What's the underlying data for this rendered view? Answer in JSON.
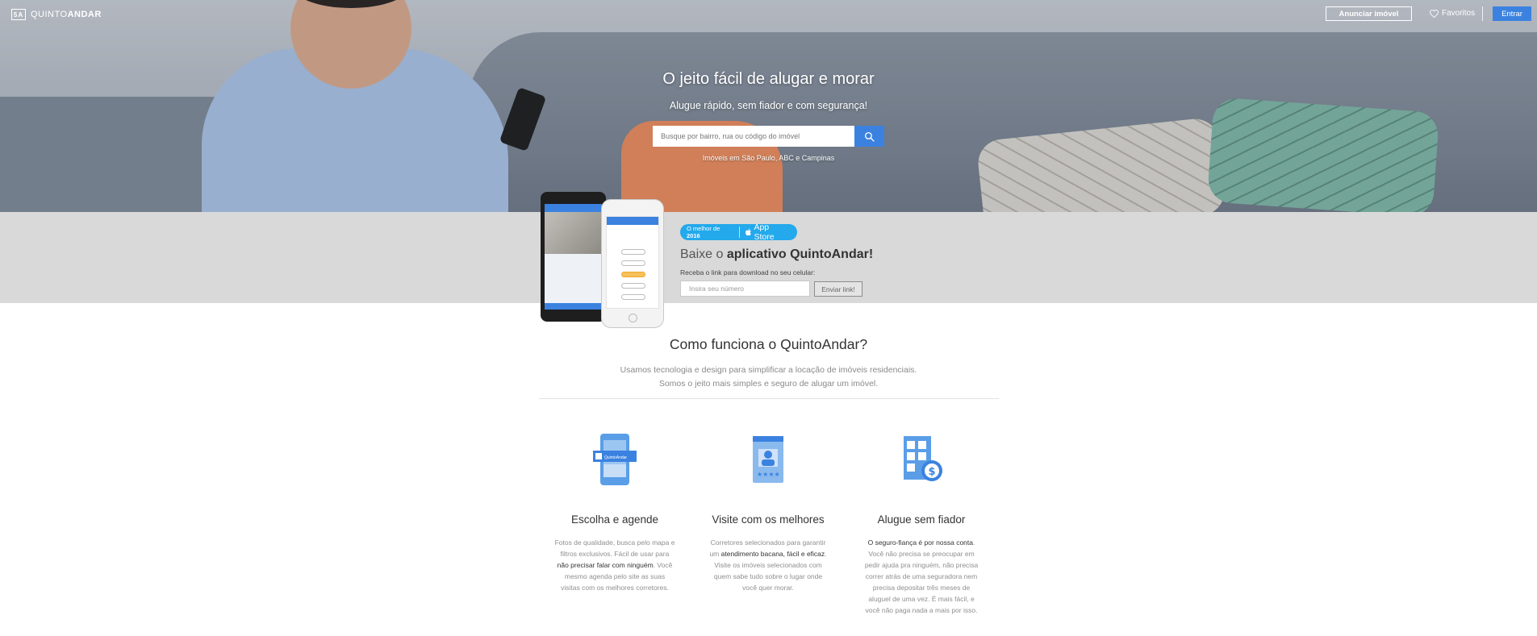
{
  "header": {
    "logo_mark": "5A",
    "logo_prefix": "QUINTO",
    "logo_suffix": "ANDAR",
    "anunciar_label": "Anunciar imóvel",
    "favoritos_label": "Favoritos",
    "entrar_label": "Entrar"
  },
  "hero": {
    "title": "O jeito fácil de alugar e morar",
    "subtitle": "Alugue rápido, sem fiador e com segurança!",
    "search_placeholder": "Busque por bairro, rua ou código do imóvel",
    "cities": "Imóveis em São Paulo, ABC e Campinas"
  },
  "app": {
    "badge_prefix": "O melhor de",
    "badge_year": "2016",
    "badge_store": "App Store",
    "heading_prefix": "Baixe o",
    "heading_bold": "aplicativo QuintoAndar!",
    "label": "Receba o link para download no seu celular:",
    "phone_placeholder": "Insira seu número",
    "send_label": "Enviar link!"
  },
  "how": {
    "title": "Como funciona o QuintoAndar?",
    "sub_line1": "Usamos tecnologia e design para simplificar a locação de imóveis residenciais.",
    "sub_line2": "Somos o jeito mais simples e seguro de alugar um imóvel.",
    "features": [
      {
        "title": "Escolha e agende",
        "icon": "phone-app-icon",
        "icon_label": "QuintoAndar",
        "p1": "Fotos de qualidade, busca pelo mapa e filtros exclusivos. Fácil de usar para ",
        "b1": "não precisar falar com ninguém",
        "p2": ". Você mesmo agenda pelo site as suas visitas com os melhores corretores."
      },
      {
        "title": "Visite com os melhores",
        "icon": "agent-badge-icon",
        "p1": "Corretores selecionados para garantir um ",
        "b1": "atendimento bacana, fácil e eficaz",
        "p2": ". Visite os imóveis selecionados com quem sabe tudo sobre o lugar onde você quer morar."
      },
      {
        "title": "Alugue sem fiador",
        "icon": "building-money-icon",
        "b0": "O seguro-fiança é por nossa conta",
        "p1": ". Você não precisa se preocupar em pedir ajuda pra ninguém, não precisa correr atrás de uma seguradora nem precisa depositar três meses de aluguel de uma vez. É mais fácil, e você não paga nada a mais por isso."
      }
    ]
  },
  "colors": {
    "accent": "#3b82e0",
    "badge": "#23a9ec",
    "band": "#d9d9d9"
  }
}
